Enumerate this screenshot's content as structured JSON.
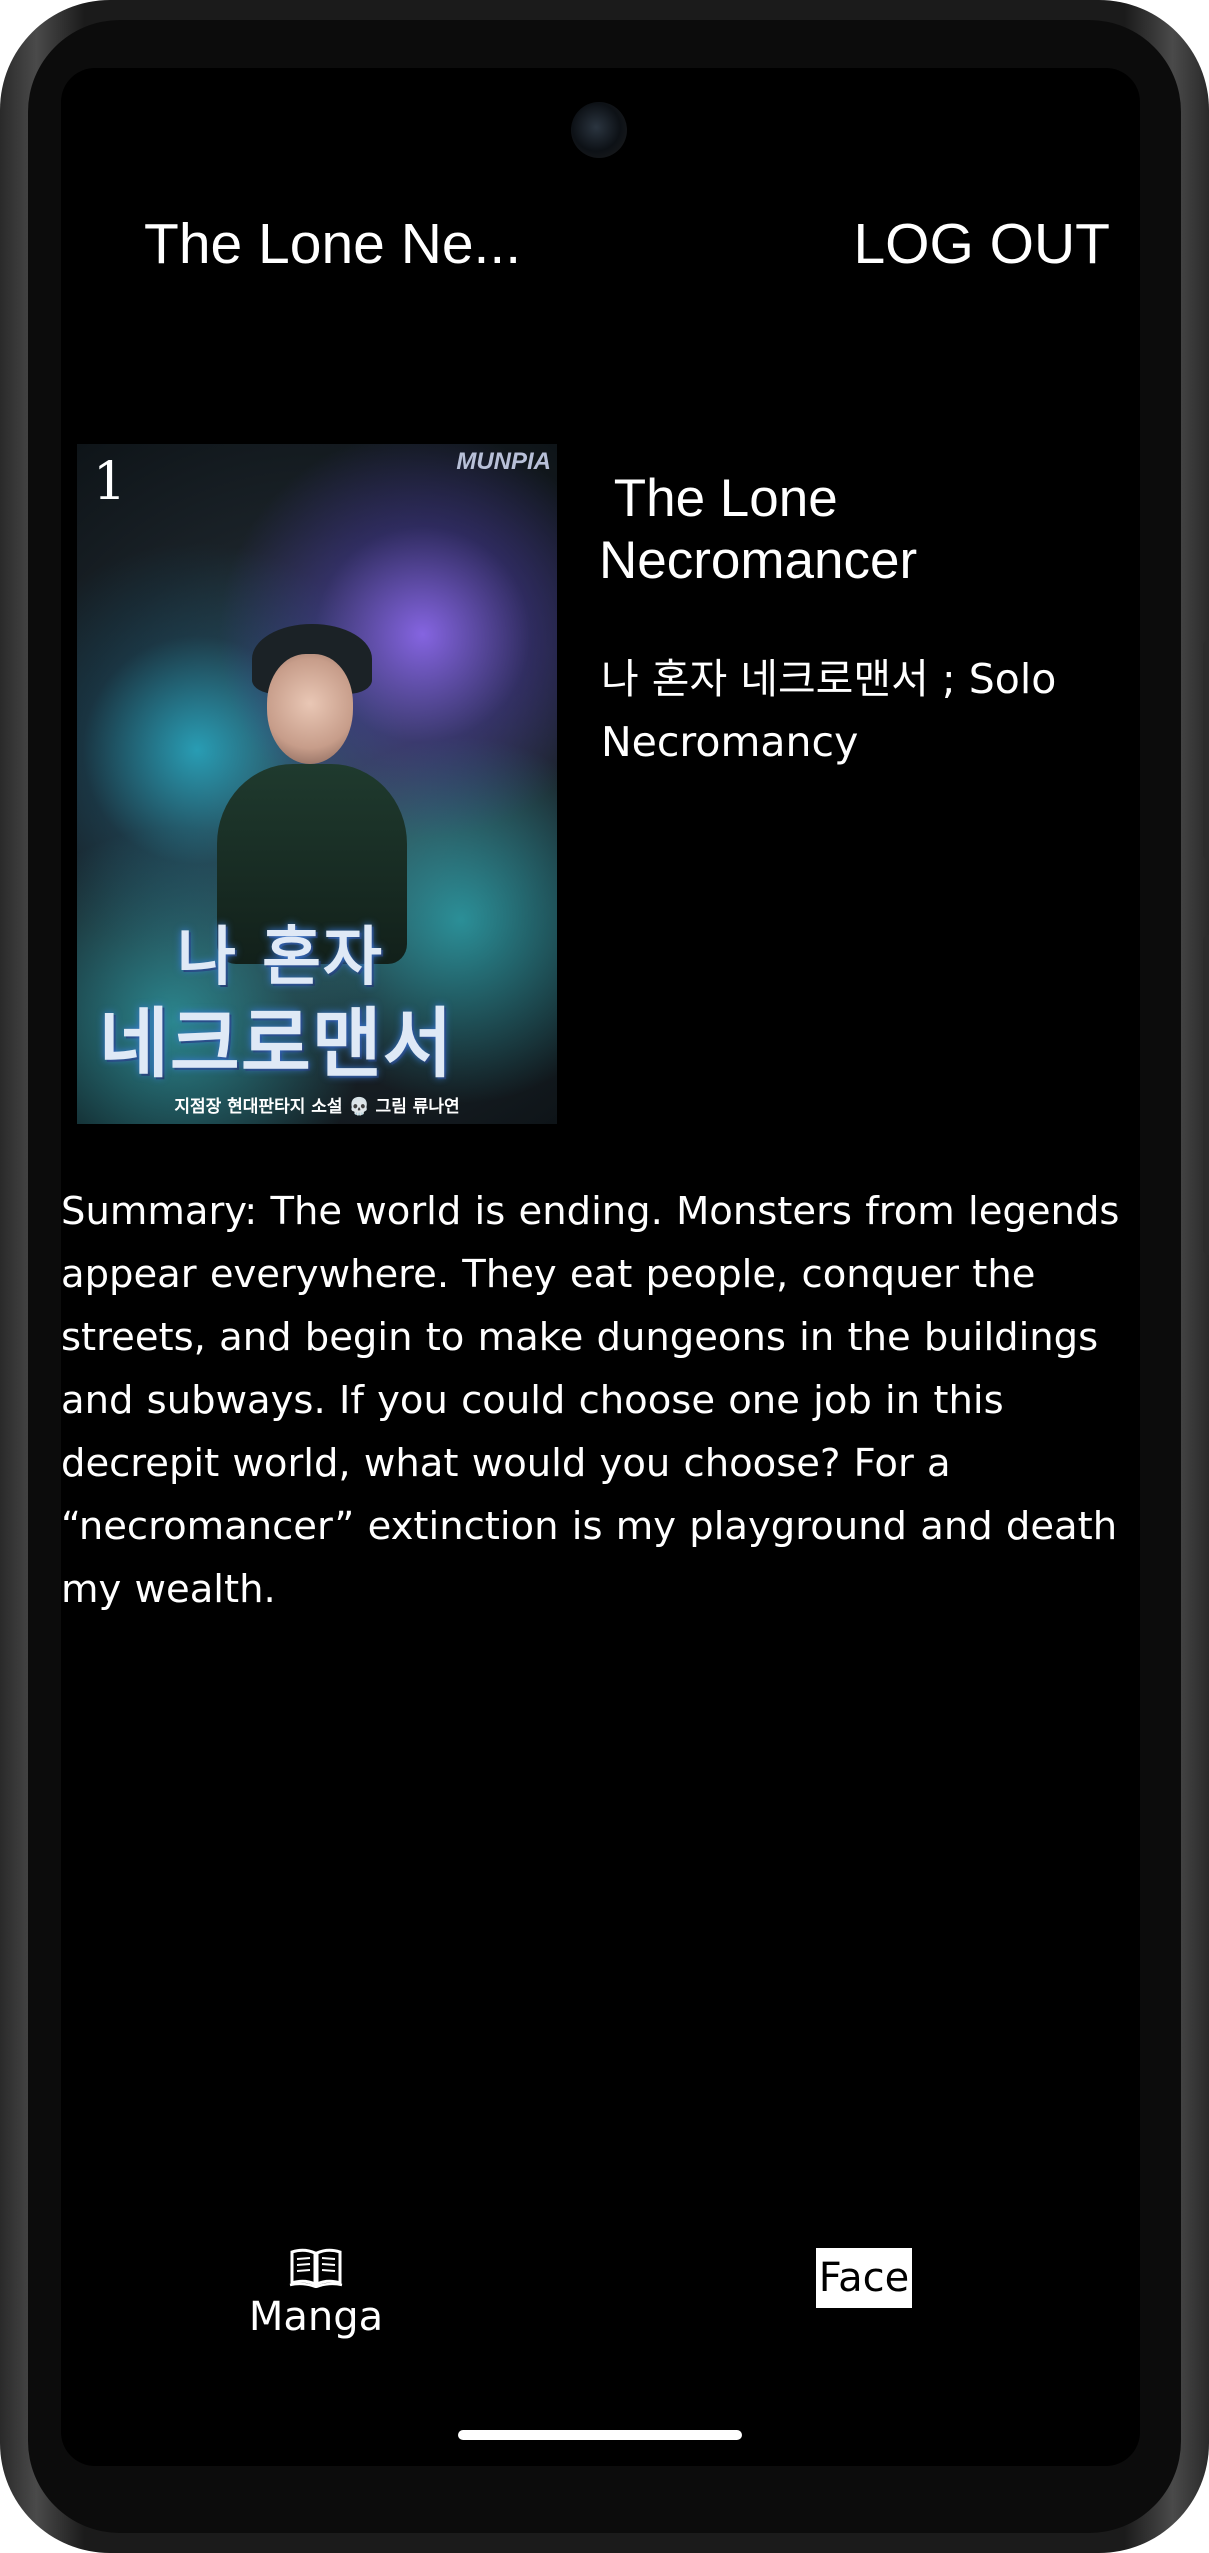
{
  "header": {
    "title": "The Lone Ne...",
    "logout_label": "LOG OUT"
  },
  "cover": {
    "volume_number": "1",
    "publisher": "MUNPIA",
    "title_line1": "나 혼자",
    "title_line2": "네크로맨서",
    "credit": "지점장 현대판타지 소설 💀 그림 류나연"
  },
  "detail": {
    "title": " The Lone\nNecromancer",
    "alt_title": "나 혼자 네크로맨서 ; Solo Necromancy",
    "summary": "Summary: The world is ending. Monsters from legends appear everywhere. They eat people, conquer the streets, and begin to make dungeons in the buildings and subways. If you could choose one job in this decrepit world, what would you choose? For a “necromancer” extinction is my playground and death my wealth."
  },
  "bottom_nav": {
    "manga_icon": "book-icon",
    "manga_label": "Manga",
    "face_label": "Face"
  },
  "colors": {
    "background": "#000000",
    "text": "#ffffff"
  }
}
